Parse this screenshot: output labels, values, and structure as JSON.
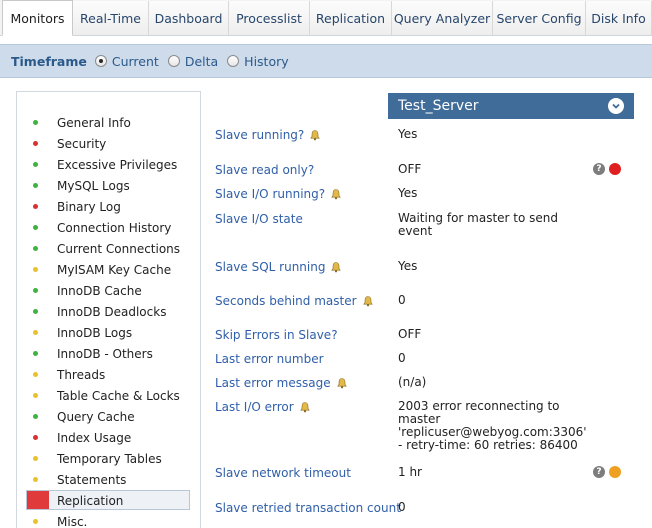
{
  "tabs": [
    {
      "label": "Monitors",
      "active": true
    },
    {
      "label": "Real-Time",
      "active": false
    },
    {
      "label": "Dashboard",
      "active": false
    },
    {
      "label": "Processlist",
      "active": false
    },
    {
      "label": "Replication",
      "active": false
    },
    {
      "label": "Query Analyzer",
      "active": false
    },
    {
      "label": "Server Config",
      "active": false
    },
    {
      "label": "Disk Info",
      "active": false
    }
  ],
  "timeframe": {
    "label": "Timeframe",
    "options": [
      {
        "label": "Current",
        "checked": true
      },
      {
        "label": "Delta",
        "checked": false
      },
      {
        "label": "History",
        "checked": false
      }
    ]
  },
  "sidebar": {
    "items": [
      {
        "label": "General Info",
        "status": "green"
      },
      {
        "label": "Security",
        "status": "red"
      },
      {
        "label": "Excessive Privileges",
        "status": "green"
      },
      {
        "label": "MySQL Logs",
        "status": "green"
      },
      {
        "label": "Binary Log",
        "status": "red"
      },
      {
        "label": "Connection History",
        "status": "green"
      },
      {
        "label": "Current Connections",
        "status": "green"
      },
      {
        "label": "MyISAM Key Cache",
        "status": "yellow"
      },
      {
        "label": "InnoDB Cache",
        "status": "green"
      },
      {
        "label": "InnoDB Deadlocks",
        "status": "green"
      },
      {
        "label": "InnoDB Logs",
        "status": "yellow"
      },
      {
        "label": "InnoDB - Others",
        "status": "green"
      },
      {
        "label": "Threads",
        "status": "yellow"
      },
      {
        "label": "Table Cache & Locks",
        "status": "yellow"
      },
      {
        "label": "Query Cache",
        "status": "green"
      },
      {
        "label": "Index Usage",
        "status": "red"
      },
      {
        "label": "Temporary Tables",
        "status": "yellow"
      },
      {
        "label": "Statements",
        "status": "yellow"
      },
      {
        "label": "Replication",
        "status": "red",
        "selected": true
      },
      {
        "label": "Misc.",
        "status": "yellow"
      }
    ]
  },
  "colors": {
    "green": "#3fb33f",
    "red": "#d93030",
    "yellow": "#e8c22a",
    "orange_status": "#f0a020",
    "red_status": "#e02020"
  },
  "server": {
    "name": "Test_Server",
    "rows": [
      {
        "label": "Slave running?",
        "bell": true,
        "value": "Yes"
      },
      {
        "label": "Slave read only?",
        "bell": false,
        "value": "OFF",
        "status": "red"
      },
      {
        "label": "Slave I/O running?",
        "bell": true,
        "value": "Yes"
      },
      {
        "label": "Slave I/O state",
        "bell": false,
        "value": "Waiting for master to send event"
      },
      {
        "label": "Slave SQL running",
        "bell": true,
        "value": "Yes"
      },
      {
        "label": "Seconds behind master",
        "bell": true,
        "value": "0"
      },
      {
        "label": "Skip Errors in Slave?",
        "bell": false,
        "value": "OFF"
      },
      {
        "label": "Last error number",
        "bell": false,
        "value": "0"
      },
      {
        "label": "Last error message",
        "bell": true,
        "value": "(n/a)"
      },
      {
        "label": "Last I/O error",
        "bell": true,
        "value": "2003 error reconnecting to master 'replicuser@webyog.com:3306' - retry-time: 60 retries: 86400"
      },
      {
        "label": "Slave network timeout",
        "bell": false,
        "value": "1 hr",
        "status": "orange"
      },
      {
        "label": "Slave retried transaction count",
        "bell": false,
        "value": "0"
      }
    ]
  }
}
